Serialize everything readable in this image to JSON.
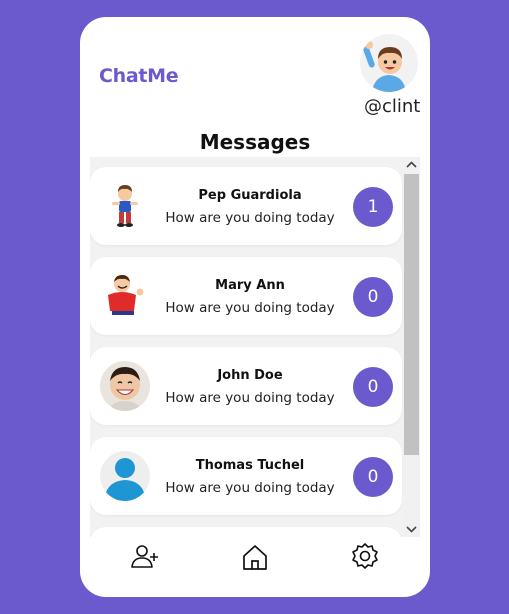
{
  "app": {
    "brand": "ChatMe"
  },
  "user": {
    "handle": "@clint"
  },
  "page": {
    "title": "Messages"
  },
  "colors": {
    "accent": "#6a5acd",
    "background": "#6a5acd",
    "card": "#ffffff"
  },
  "conversations": [
    {
      "name": "Pep Guardiola",
      "preview": "How are you doing today",
      "unread": "1",
      "avatar": "cartoon-boy-avatar"
    },
    {
      "name": "Mary Ann",
      "preview": "How are you doing today",
      "unread": "0",
      "avatar": "cartoon-red-shirt-avatar"
    },
    {
      "name": "John Doe",
      "preview": "How are you doing today",
      "unread": "0",
      "avatar": "child-photo-avatar"
    },
    {
      "name": "Thomas Tuchel",
      "preview": "How are you doing today",
      "unread": "0",
      "avatar": "default-user-avatar"
    }
  ],
  "nav": {
    "items": [
      "add-user-icon",
      "home-icon",
      "settings-icon"
    ]
  }
}
